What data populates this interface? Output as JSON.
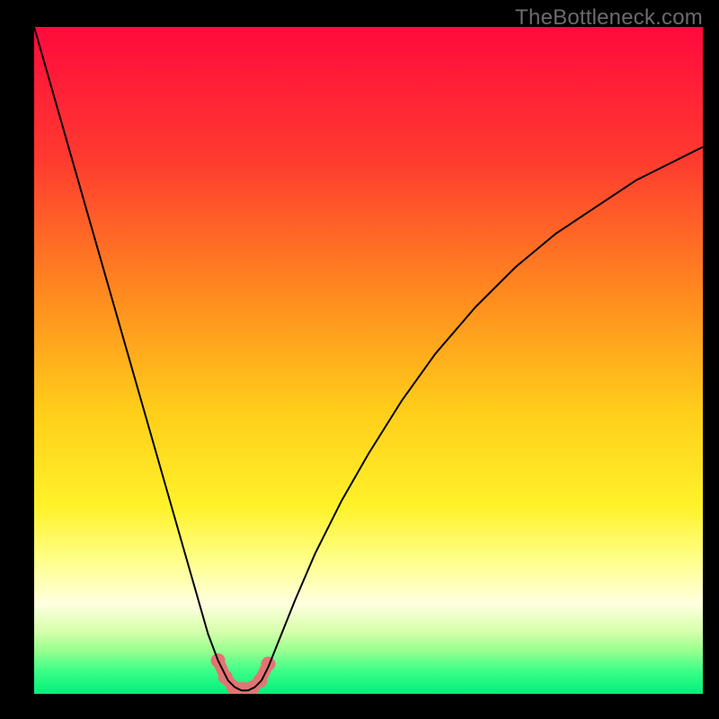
{
  "watermark": "TheBottleneck.com",
  "chart_data": {
    "type": "line",
    "title": "",
    "xlabel": "",
    "ylabel": "",
    "xlim": [
      0,
      100
    ],
    "ylim": [
      0,
      100
    ],
    "grid": false,
    "legend": false,
    "annotations": [],
    "background": {
      "type": "vertical-gradient",
      "stops": [
        {
          "pos": 0.0,
          "color": "#ff0a3d"
        },
        {
          "pos": 0.2,
          "color": "#ff3b2f"
        },
        {
          "pos": 0.4,
          "color": "#ff8a1f"
        },
        {
          "pos": 0.58,
          "color": "#ffcf1a"
        },
        {
          "pos": 0.72,
          "color": "#fff22a"
        },
        {
          "pos": 0.8,
          "color": "#ffff8a"
        },
        {
          "pos": 0.865,
          "color": "#ffffe0"
        },
        {
          "pos": 0.905,
          "color": "#d8ffad"
        },
        {
          "pos": 0.935,
          "color": "#99ff8f"
        },
        {
          "pos": 0.965,
          "color": "#3dff88"
        },
        {
          "pos": 1.0,
          "color": "#00f07b"
        }
      ]
    },
    "series": [
      {
        "name": "bottleneck-curve",
        "color": "#000000",
        "stroke_width": 2,
        "x": [
          0,
          2,
          4,
          6,
          8,
          10,
          12,
          14,
          16,
          18,
          20,
          22,
          24,
          26,
          27.5,
          29,
          30,
          31,
          32,
          33,
          34,
          35,
          37,
          39,
          42,
          46,
          50,
          55,
          60,
          66,
          72,
          78,
          84,
          90,
          96,
          100
        ],
        "y": [
          100,
          93,
          86,
          79,
          72,
          65,
          58,
          51,
          44,
          37,
          30,
          23,
          16,
          9,
          5,
          2,
          1,
          0.5,
          0.5,
          1,
          2,
          4,
          9,
          14,
          21,
          29,
          36,
          44,
          51,
          58,
          64,
          69,
          73,
          77,
          80,
          82
        ]
      }
    ],
    "markers": [
      {
        "name": "left-dip-dot-1",
        "x": 27.5,
        "y": 5.0,
        "r": 8,
        "color": "#e57373"
      },
      {
        "name": "left-dip-dot-2",
        "x": 28.6,
        "y": 2.5,
        "r": 8,
        "color": "#e57373"
      },
      {
        "name": "floor-dot-1",
        "x": 29.8,
        "y": 1.0,
        "r": 8,
        "color": "#e57373"
      },
      {
        "name": "floor-dot-2",
        "x": 31.2,
        "y": 0.7,
        "r": 8,
        "color": "#e57373"
      },
      {
        "name": "floor-dot-3",
        "x": 32.6,
        "y": 0.9,
        "r": 8,
        "color": "#e57373"
      },
      {
        "name": "right-dip-dot-1",
        "x": 33.8,
        "y": 2.0,
        "r": 8,
        "color": "#e57373"
      },
      {
        "name": "right-dip-dot-2",
        "x": 35.0,
        "y": 4.5,
        "r": 8,
        "color": "#e57373"
      }
    ]
  }
}
